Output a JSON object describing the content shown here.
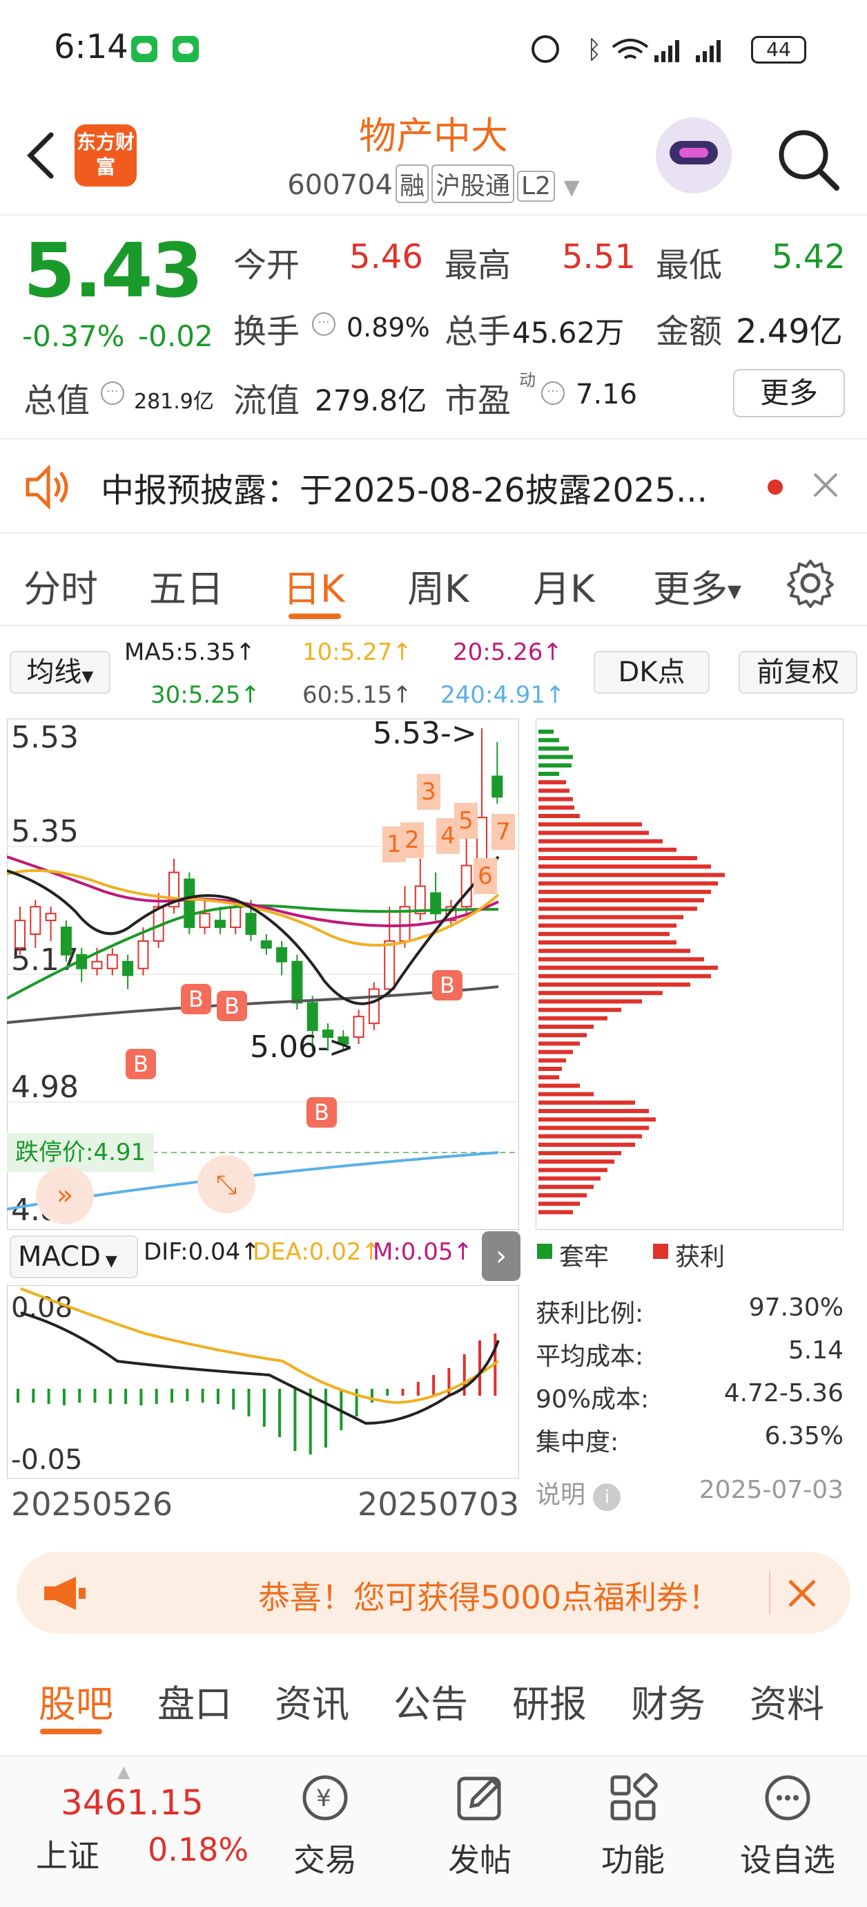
{
  "status_bar": {
    "time": "6:14",
    "battery": "44",
    "signal_icons": "wifi, bluetooth, cellular"
  },
  "header": {
    "title": "物产中大",
    "code": "600704",
    "tags": [
      "融",
      "沪股通",
      "L2"
    ],
    "logo_text": "东方财富"
  },
  "quote": {
    "price": "5.43",
    "change_pct": "-0.37%",
    "change": "-0.02",
    "open_label": "今开",
    "open": "5.46",
    "high_label": "最高",
    "high": "5.51",
    "low_label": "最低",
    "low": "5.42",
    "turnover_label": "换手",
    "turnover": "0.89%",
    "volume_label": "总手",
    "volume": "45.62万",
    "amount_label": "金额",
    "amount": "2.49亿",
    "mktcap_label": "总值",
    "mktcap": "281.9亿",
    "float_label": "流值",
    "float_cap": "279.8亿",
    "pe_label": "市盈",
    "pe_sup": "动",
    "pe": "7.16",
    "more_label": "更多"
  },
  "notice": {
    "text": "中报预披露：于2025-08-26披露2025..."
  },
  "chart_tabs": [
    {
      "label": "分时"
    },
    {
      "label": "五日"
    },
    {
      "label": "日K"
    },
    {
      "label": "周K"
    },
    {
      "label": "月K"
    },
    {
      "label": "更多"
    }
  ],
  "ma": {
    "selector": "均线",
    "ma5": "MA5:5.35↑",
    "ma10": "10:5.27↑",
    "ma20": "20:5.26↑",
    "ma30": "30:5.25↑",
    "ma60": "60:5.15↑",
    "ma240": "240:4.91↑",
    "dk_label": "DK点",
    "adjust_label": "前复权"
  },
  "kchart": {
    "price_labels": [
      "5.53",
      "5.35",
      "5.17",
      "4.98",
      "4.80"
    ],
    "high_marker": "5.53->",
    "low_marker": "5.06->",
    "limit_down_label": "跌停价:4.91",
    "buy_label": "B",
    "num_labels": [
      "1",
      "2",
      "3",
      "4",
      "5",
      "6",
      "7"
    ],
    "colors": {
      "up": "#e0312b",
      "down": "#1a9a2a",
      "ma5": "#222222",
      "ma10": "#f0b020",
      "ma20": "#c0187a",
      "ma30": "#1a9a2a",
      "ma60": "#555555",
      "ma240": "#5ab0e6"
    }
  },
  "macd": {
    "selector": "MACD",
    "dif": "DIF:0.04↑",
    "dea": "DEA:0.02↑",
    "m": "M:0.05↑",
    "top": "0.08",
    "bottom": "-0.05",
    "date_start": "20250526",
    "date_end": "20250703"
  },
  "chip": {
    "legend_trapped": "套牢",
    "legend_profit": "获利",
    "stats": [
      {
        "label": "获利比例:",
        "value": "97.30%"
      },
      {
        "label": "平均成本:",
        "value": "5.14"
      },
      {
        "label": "90%成本:",
        "value": "4.72-5.36"
      },
      {
        "label": "集中度:",
        "value": "6.35%"
      }
    ],
    "note_label": "说明",
    "date": "2025-07-03"
  },
  "banner": {
    "text": "恭喜！您可获得5000点福利券！"
  },
  "bottom_tabs": [
    {
      "label": "股吧"
    },
    {
      "label": "盘口"
    },
    {
      "label": "资讯"
    },
    {
      "label": "公告"
    },
    {
      "label": "研报"
    },
    {
      "label": "财务"
    },
    {
      "label": "资料"
    }
  ],
  "nav": {
    "index_value": "3461.15",
    "index_name": "上证",
    "index_change": "0.18%",
    "items": [
      {
        "label": "交易"
      },
      {
        "label": "发帖"
      },
      {
        "label": "功能"
      },
      {
        "label": "设自选"
      }
    ]
  }
}
